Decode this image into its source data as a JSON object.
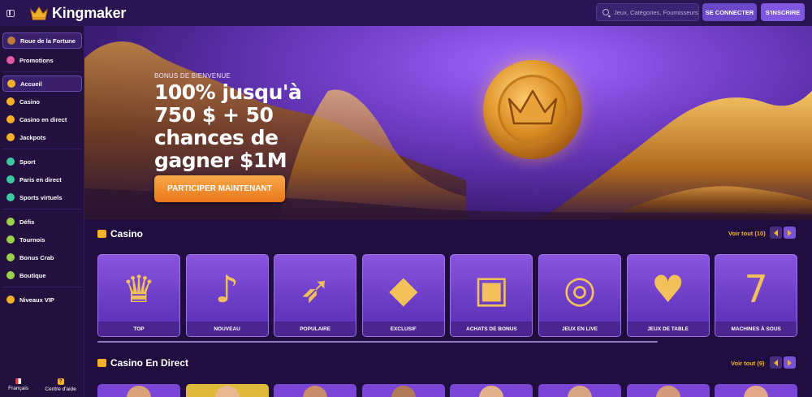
{
  "header": {
    "brand": "Kingmaker",
    "search_placeholder": "Jeux, Catégories, Fournisseurs",
    "login": "SE CONNECTER",
    "signup": "S'INSCRIRE"
  },
  "sidebar": {
    "items": [
      {
        "label": "Roue de la Fortune",
        "icon": "wheel-icon",
        "color": "#c07a3a"
      },
      {
        "label": "Promotions",
        "icon": "gift-icon",
        "color": "#e05aa0"
      },
      {
        "label": "Accueil",
        "icon": "home-icon",
        "color": "#f3b12b"
      },
      {
        "label": "Casino",
        "icon": "casino-icon",
        "color": "#f3b12b"
      },
      {
        "label": "Casino en direct",
        "icon": "live-casino-icon",
        "color": "#f3b12b"
      },
      {
        "label": "Jackpots",
        "icon": "jackpot-icon",
        "color": "#f3b12b"
      },
      {
        "label": "Sport",
        "icon": "sport-icon",
        "color": "#3ec7a0"
      },
      {
        "label": "Paris en direct",
        "icon": "live-bet-icon",
        "color": "#3ec7a0"
      },
      {
        "label": "Sports virtuels",
        "icon": "virtual-sports-icon",
        "color": "#3ec7a0"
      },
      {
        "label": "Défis",
        "icon": "challenge-icon",
        "color": "#9ad14a"
      },
      {
        "label": "Tournois",
        "icon": "trophy-icon",
        "color": "#9ad14a"
      },
      {
        "label": "Bonus Crab",
        "icon": "crab-icon",
        "color": "#9ad14a"
      },
      {
        "label": "Boutique",
        "icon": "shop-icon",
        "color": "#9ad14a"
      },
      {
        "label": "Niveaux VIP",
        "icon": "vip-icon",
        "color": "#f3b12b"
      }
    ],
    "language": "Français",
    "help": "Centre d'aide"
  },
  "hero": {
    "subtitle": "BONUS DE BIENVENUE",
    "title": "100% jusqu'à 750 $ + 50 chances de gagner $1M",
    "cta": "PARTICIPER MAINTENANT"
  },
  "casino_section": {
    "title": "Casino",
    "see_all": "Voir tout (10)",
    "cards": [
      {
        "label": "TOP",
        "icon": "crown-icon"
      },
      {
        "label": "NOUVEAU",
        "icon": "bells-icon"
      },
      {
        "label": "POPULAIRE",
        "icon": "rocket-icon"
      },
      {
        "label": "EXCLUSIF",
        "icon": "diamond-icon"
      },
      {
        "label": "ACHATS DE BONUS",
        "icon": "gift-box-icon"
      },
      {
        "label": "JEUX EN LIVE",
        "icon": "roulette-icon"
      },
      {
        "label": "JEUX DE TABLE",
        "icon": "cards-icon"
      },
      {
        "label": "MACHINES À SOUS",
        "icon": "slot-machine-icon"
      }
    ]
  },
  "live_section": {
    "title": "Casino En Direct",
    "see_all": "Voir tout (9)"
  }
}
